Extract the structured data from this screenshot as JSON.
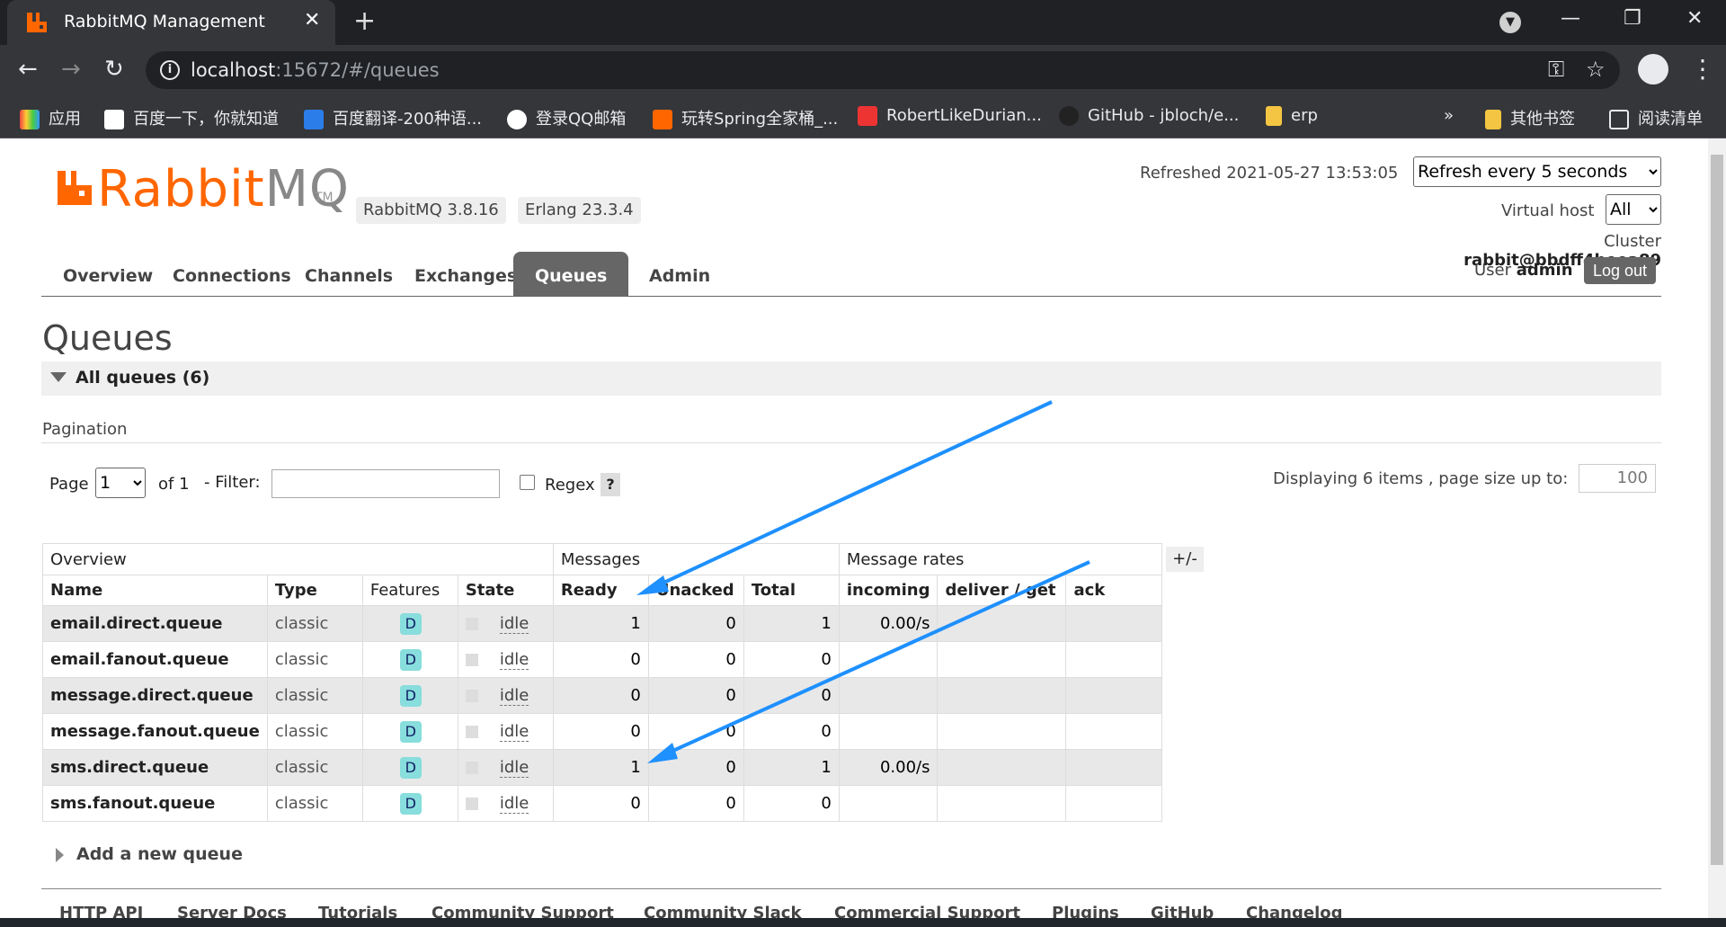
{
  "browser": {
    "tab_title": "RabbitMQ Management",
    "tab_close": "✕",
    "new_tab": "+",
    "url_host": "localhost",
    "url_rest": ":15672/#/queues",
    "bookmarks": [
      "应用",
      "百度一下，你就知道",
      "百度翻译-200种语...",
      "登录QQ邮箱",
      "玩转Spring全家桶_...",
      "RobertLikeDurian...",
      "GitHub - jbloch/e...",
      "erp",
      "»",
      "其他书签",
      "阅读清单"
    ]
  },
  "header": {
    "logo_rabbit": "Rabbit",
    "logo_mq": "MQ",
    "logo_tm": "TM",
    "version_rabbit": "RabbitMQ 3.8.16",
    "version_erlang": "Erlang 23.3.4",
    "refreshed_label": "Refreshed 2021-05-27 13:53:05",
    "refresh_option": "Refresh every 5 seconds",
    "virtual_host_label": "Virtual host",
    "virtual_host_option": "All",
    "cluster_label": "Cluster",
    "cluster_value": "rabbit@bbdff4beea89",
    "user_label": "User",
    "user_value": "admin",
    "logout_label": "Log out"
  },
  "nav_tabs": [
    "Overview",
    "Connections",
    "Channels",
    "Exchanges",
    "Queues",
    "Admin"
  ],
  "active_tab": "Queues",
  "main": {
    "title": "Queues",
    "section_label": "All queues (6)",
    "pagination_label": "Pagination",
    "page_label": "Page",
    "page_option": "1",
    "of_label": "of 1",
    "filter_label": "- Filter:",
    "regex_label": "Regex",
    "help_label": "?",
    "display_label": "Displaying 6 items , page size up to:",
    "page_size": "100",
    "plus_minus": "+/-",
    "add_queue_label": "Add a new queue"
  },
  "table": {
    "groups": [
      "Overview",
      "Messages",
      "Message rates"
    ],
    "columns": [
      "Name",
      "Type",
      "Features",
      "State",
      "Ready",
      "Unacked",
      "Total",
      "incoming",
      "deliver / get",
      "ack"
    ],
    "rows": [
      {
        "name": "email.direct.queue",
        "type": "classic",
        "feature": "D",
        "state": "idle",
        "ready": "1",
        "unacked": "0",
        "total": "1",
        "incoming": "0.00/s",
        "deliver": "",
        "ack": ""
      },
      {
        "name": "email.fanout.queue",
        "type": "classic",
        "feature": "D",
        "state": "idle",
        "ready": "0",
        "unacked": "0",
        "total": "0",
        "incoming": "",
        "deliver": "",
        "ack": ""
      },
      {
        "name": "message.direct.queue",
        "type": "classic",
        "feature": "D",
        "state": "idle",
        "ready": "0",
        "unacked": "0",
        "total": "0",
        "incoming": "",
        "deliver": "",
        "ack": ""
      },
      {
        "name": "message.fanout.queue",
        "type": "classic",
        "feature": "D",
        "state": "idle",
        "ready": "0",
        "unacked": "0",
        "total": "0",
        "incoming": "",
        "deliver": "",
        "ack": ""
      },
      {
        "name": "sms.direct.queue",
        "type": "classic",
        "feature": "D",
        "state": "idle",
        "ready": "1",
        "unacked": "0",
        "total": "1",
        "incoming": "0.00/s",
        "deliver": "",
        "ack": ""
      },
      {
        "name": "sms.fanout.queue",
        "type": "classic",
        "feature": "D",
        "state": "idle",
        "ready": "0",
        "unacked": "0",
        "total": "0",
        "incoming": "",
        "deliver": "",
        "ack": ""
      }
    ]
  },
  "footer": [
    "HTTP API",
    "Server Docs",
    "Tutorials",
    "Community Support",
    "Community Slack",
    "Commercial Support",
    "Plugins",
    "GitHub",
    "Changelog"
  ],
  "colors": {
    "brand": "#ff6600",
    "annotation_arrow": "#1e90ff",
    "active_tab": "#666666"
  }
}
